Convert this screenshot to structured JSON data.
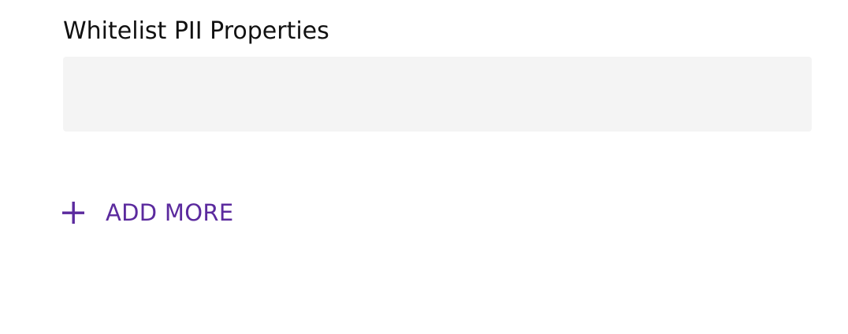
{
  "form": {
    "whitelist_pii": {
      "label": "Whitelist PII Properties",
      "value": "",
      "placeholder": ""
    },
    "add_more": {
      "label": "ADD MORE",
      "icon": "plus-icon"
    }
  },
  "colors": {
    "label_text": "#111111",
    "input_background": "#f4f4f4",
    "accent": "#5b2a9e"
  }
}
